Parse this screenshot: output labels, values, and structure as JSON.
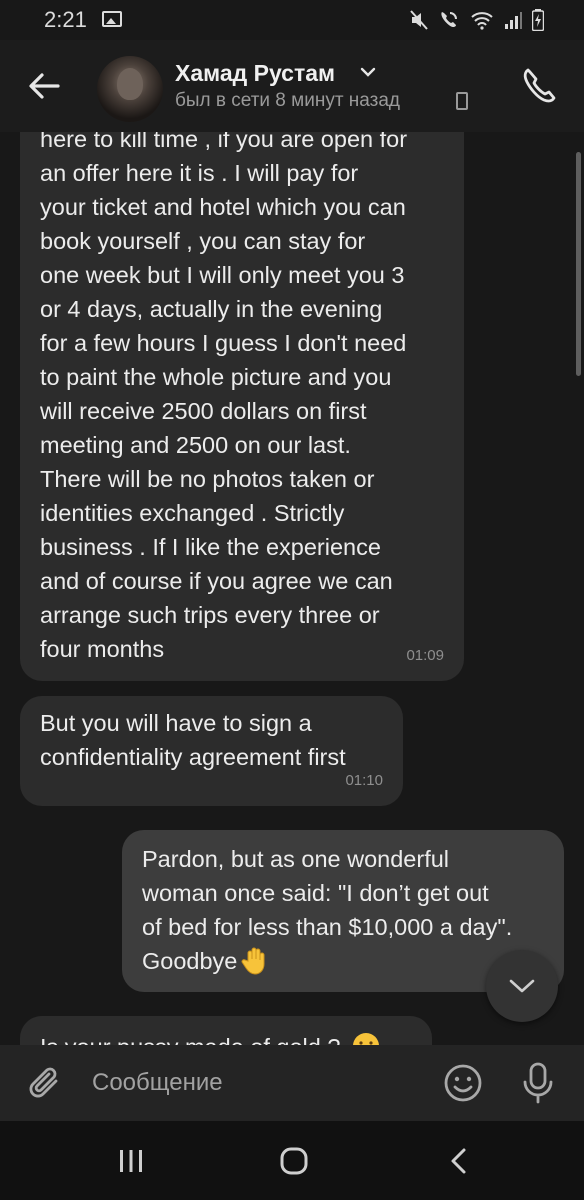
{
  "status_bar": {
    "time": "2:21",
    "icons": [
      "gallery-icon",
      "mute-icon",
      "wifi-call-icon",
      "wifi-icon",
      "signal-icon",
      "battery-icon"
    ]
  },
  "header": {
    "contact_name": "Хамад Рустам",
    "last_seen": "был в сети 8 минут назад",
    "icons": [
      "back-arrow-icon",
      "chevron-down-icon",
      "mobile-icon",
      "phone-icon"
    ]
  },
  "messages": [
    {
      "direction": "incoming",
      "text": "here to kill time , if you are open for\nan offer here it is . I will pay for\nyour ticket and hotel which you can\nbook yourself , you can stay for\none week but I will only meet you 3\nor 4 days, actually in the evening\nfor a few hours I guess I don't need\nto paint the whole picture and you\nwill receive 2500 dollars on first\nmeeting and 2500 on our last.\nThere will be no photos taken or\nidentities exchanged . Strictly\nbusiness . If I like the experience\nand of course if you agree we can\narrange such trips every three or\nfour months",
      "time": "01:09"
    },
    {
      "direction": "incoming",
      "text": "But you will have to sign a\nconfidentiality agreement first",
      "time": "01:10"
    },
    {
      "direction": "outgoing",
      "text": "Pardon, but as one wonderful\nwoman once said: \"I don’t get out\nof bed for less than $10,000 a day\".\nGoodbye",
      "emoji": "raised-hand-icon"
    },
    {
      "direction": "incoming",
      "text": "Is your pussy made of gold ?",
      "emoji": "grinning-sweat-icon"
    }
  ],
  "compose": {
    "placeholder": "Сообщение",
    "icons": [
      "paperclip-icon",
      "emoji-icon",
      "microphone-icon"
    ]
  },
  "colors": {
    "background": "#181818",
    "incoming_bubble": "#2c2c2c",
    "outgoing_bubble": "#3d3d3d",
    "emoji_yellow": "#f7c33a"
  },
  "nav_bar": {
    "icons": [
      "recent-apps-icon",
      "home-icon",
      "back-icon"
    ]
  }
}
